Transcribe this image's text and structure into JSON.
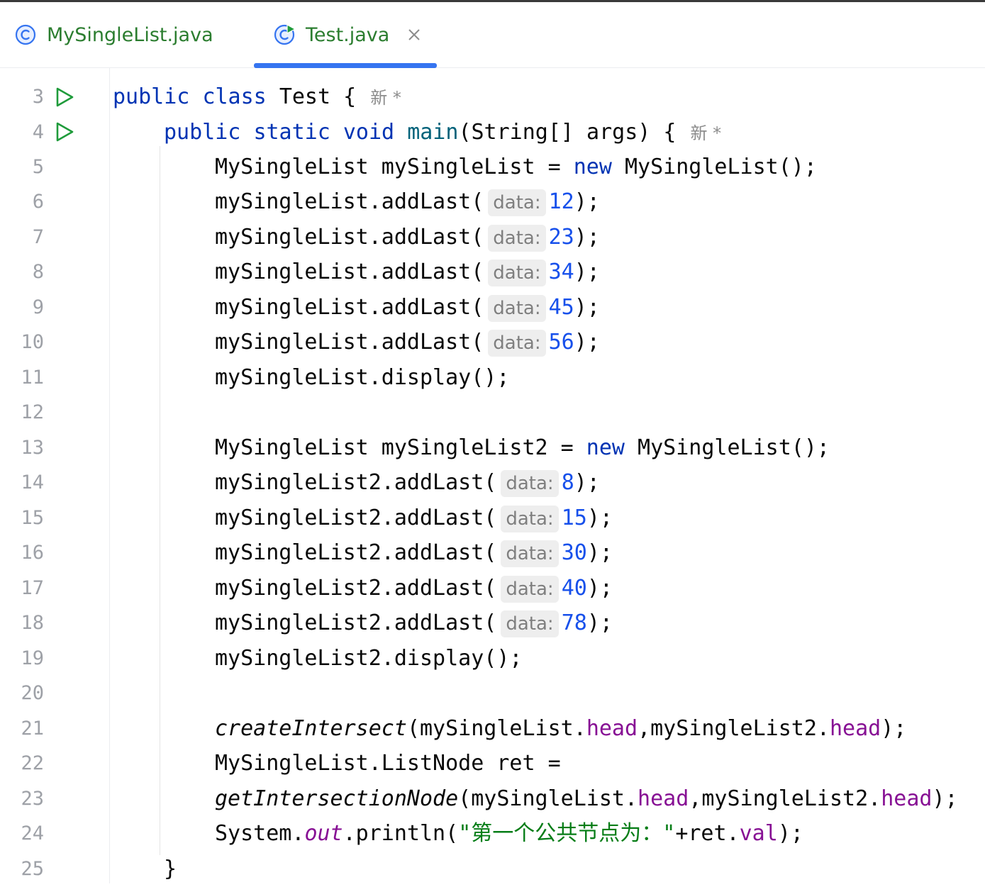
{
  "tabs": [
    {
      "label": "MySingleList.java",
      "icon": "class-icon",
      "active": false
    },
    {
      "label": "Test.java",
      "icon": "class-run-icon",
      "active": true,
      "close": "×"
    }
  ],
  "colors": {
    "keyword": "#0033b3",
    "method": "#00627a",
    "number": "#1750eb",
    "field": "#871094",
    "string": "#067d17",
    "tab_text": "#2b7d2f",
    "tab_underline": "#3574f0",
    "run_icon": "#1f9b3b"
  },
  "hint_label": "data:",
  "author_hint": "新 *",
  "lines": [
    {
      "n": "3",
      "run": true
    },
    {
      "n": "4",
      "run": true
    },
    {
      "n": "5"
    },
    {
      "n": "6"
    },
    {
      "n": "7"
    },
    {
      "n": "8"
    },
    {
      "n": "9"
    },
    {
      "n": "10"
    },
    {
      "n": "11"
    },
    {
      "n": "12"
    },
    {
      "n": "13"
    },
    {
      "n": "14"
    },
    {
      "n": "15"
    },
    {
      "n": "16"
    },
    {
      "n": "17"
    },
    {
      "n": "18"
    },
    {
      "n": "19"
    },
    {
      "n": "20"
    },
    {
      "n": "21"
    },
    {
      "n": "22"
    },
    {
      "n": "23"
    },
    {
      "n": "24"
    },
    {
      "n": "25"
    }
  ],
  "code": {
    "l3": {
      "kw1": "public",
      "kw2": "class",
      "name": "Test",
      "brace": " {"
    },
    "l4": {
      "kw1": "public",
      "kw2": "static",
      "kw3": "void",
      "fn": "main",
      "rest": "(String[] args) {"
    },
    "l5": {
      "a": "MySingleList mySingleList = ",
      "kw": "new",
      "b": " MySingleList();"
    },
    "list1_var": "mySingleList.addLast(",
    "list1_values": [
      "12",
      "23",
      "34",
      "45",
      "56"
    ],
    "l11": "mySingleList.display();",
    "l13": {
      "a": "MySingleList mySingleList2 = ",
      "kw": "new",
      "b": " MySingleList();"
    },
    "list2_var": "mySingleList2.addLast(",
    "list2_values": [
      "8",
      "15",
      "30",
      "40",
      "78"
    ],
    "close_call": ");",
    "l19": "mySingleList2.display();",
    "l21": {
      "fn": "createIntersect",
      "a": "(mySingleList.",
      "f1": "head",
      "b": ",mySingleList2.",
      "f2": "head",
      "c": ");"
    },
    "l22": "MySingleList.ListNode ret =",
    "l23": {
      "fn": "getIntersectionNode",
      "a": "(mySingleList.",
      "f1": "head",
      "b": ",mySingleList2.",
      "f2": "head",
      "c": ");"
    },
    "l24": {
      "a": "System.",
      "out": "out",
      "b": ".println(",
      "str": "\"第一个公共节点为：\"",
      "c": "+ret.",
      "f": "val",
      "d": ");"
    },
    "l25": "}"
  }
}
